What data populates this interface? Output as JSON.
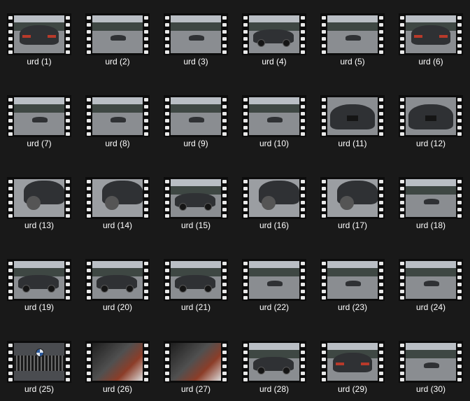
{
  "explorer": {
    "items": [
      {
        "label": "urd (1)",
        "scene": "rear"
      },
      {
        "label": "urd (2)",
        "scene": "far"
      },
      {
        "label": "urd (3)",
        "scene": "far"
      },
      {
        "label": "urd (4)",
        "scene": "side"
      },
      {
        "label": "urd (5)",
        "scene": "far"
      },
      {
        "label": "urd (6)",
        "scene": "rear"
      },
      {
        "label": "urd (7)",
        "scene": "far"
      },
      {
        "label": "urd (8)",
        "scene": "far"
      },
      {
        "label": "urd (9)",
        "scene": "far"
      },
      {
        "label": "urd (10)",
        "scene": "far"
      },
      {
        "label": "urd (11)",
        "scene": "front"
      },
      {
        "label": "urd (12)",
        "scene": "front"
      },
      {
        "label": "urd (13)",
        "scene": "wheel"
      },
      {
        "label": "urd (14)",
        "scene": "wheel"
      },
      {
        "label": "urd (15)",
        "scene": "side"
      },
      {
        "label": "urd (16)",
        "scene": "wheel"
      },
      {
        "label": "urd (17)",
        "scene": "wheel"
      },
      {
        "label": "urd (18)",
        "scene": "far"
      },
      {
        "label": "urd (19)",
        "scene": "side"
      },
      {
        "label": "urd (20)",
        "scene": "side"
      },
      {
        "label": "urd (21)",
        "scene": "side"
      },
      {
        "label": "urd (22)",
        "scene": "far"
      },
      {
        "label": "urd (23)",
        "scene": "far"
      },
      {
        "label": "urd (24)",
        "scene": "far"
      },
      {
        "label": "urd (25)",
        "scene": "badge"
      },
      {
        "label": "urd (26)",
        "scene": "interior"
      },
      {
        "label": "urd (27)",
        "scene": "interior"
      },
      {
        "label": "urd (28)",
        "scene": "side"
      },
      {
        "label": "urd (29)",
        "scene": "rear"
      },
      {
        "label": "urd (30)",
        "scene": "far"
      }
    ]
  },
  "colors": {
    "background": "#191919",
    "label_text": "#ffffff",
    "film_strip": "#0c0c0c",
    "sprocket_hole": "#e9e9e9"
  },
  "icons": {
    "thumbnail_overlay": "film-strip-icon"
  }
}
